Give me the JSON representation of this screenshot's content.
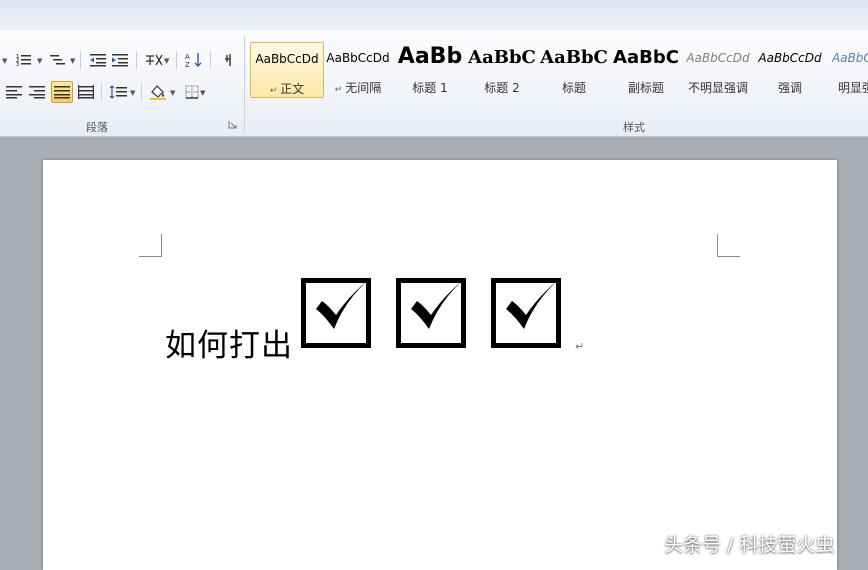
{
  "ribbon": {
    "paragraph_group": {
      "label": "段落"
    },
    "styles_group": {
      "label": "样式",
      "styles": [
        {
          "sample": "AaBbCcDd",
          "name": "正文",
          "selected": true
        },
        {
          "sample": "AaBbCcDd",
          "name": "无间隔",
          "selected": false
        },
        {
          "sample": "AaBb",
          "name": "标题 1",
          "selected": false
        },
        {
          "sample": "AaBbC",
          "name": "标题 2",
          "selected": false
        },
        {
          "sample": "AaBbC",
          "name": "标题",
          "selected": false
        },
        {
          "sample": "AaBbC",
          "name": "副标题",
          "selected": false
        },
        {
          "sample": "AaBbCcDd",
          "name": "不明显强调",
          "selected": false
        },
        {
          "sample": "AaBbCcDd",
          "name": "强调",
          "selected": false
        },
        {
          "sample": "AaBbCcDd",
          "name": "明显强",
          "selected": false
        }
      ]
    }
  },
  "document": {
    "text": "如何打出",
    "checkbox_count": 3,
    "paragraph_mark": "↵"
  },
  "watermark": "头条号 / 科技萤火虫",
  "colors": {
    "ribbon_bg": "#f1f4f9",
    "selected_style_border": "#e5b54a",
    "selected_style_bg": "#fde8a8",
    "workspace_bg": "#a9adb4",
    "page_bg": "#ffffff"
  }
}
